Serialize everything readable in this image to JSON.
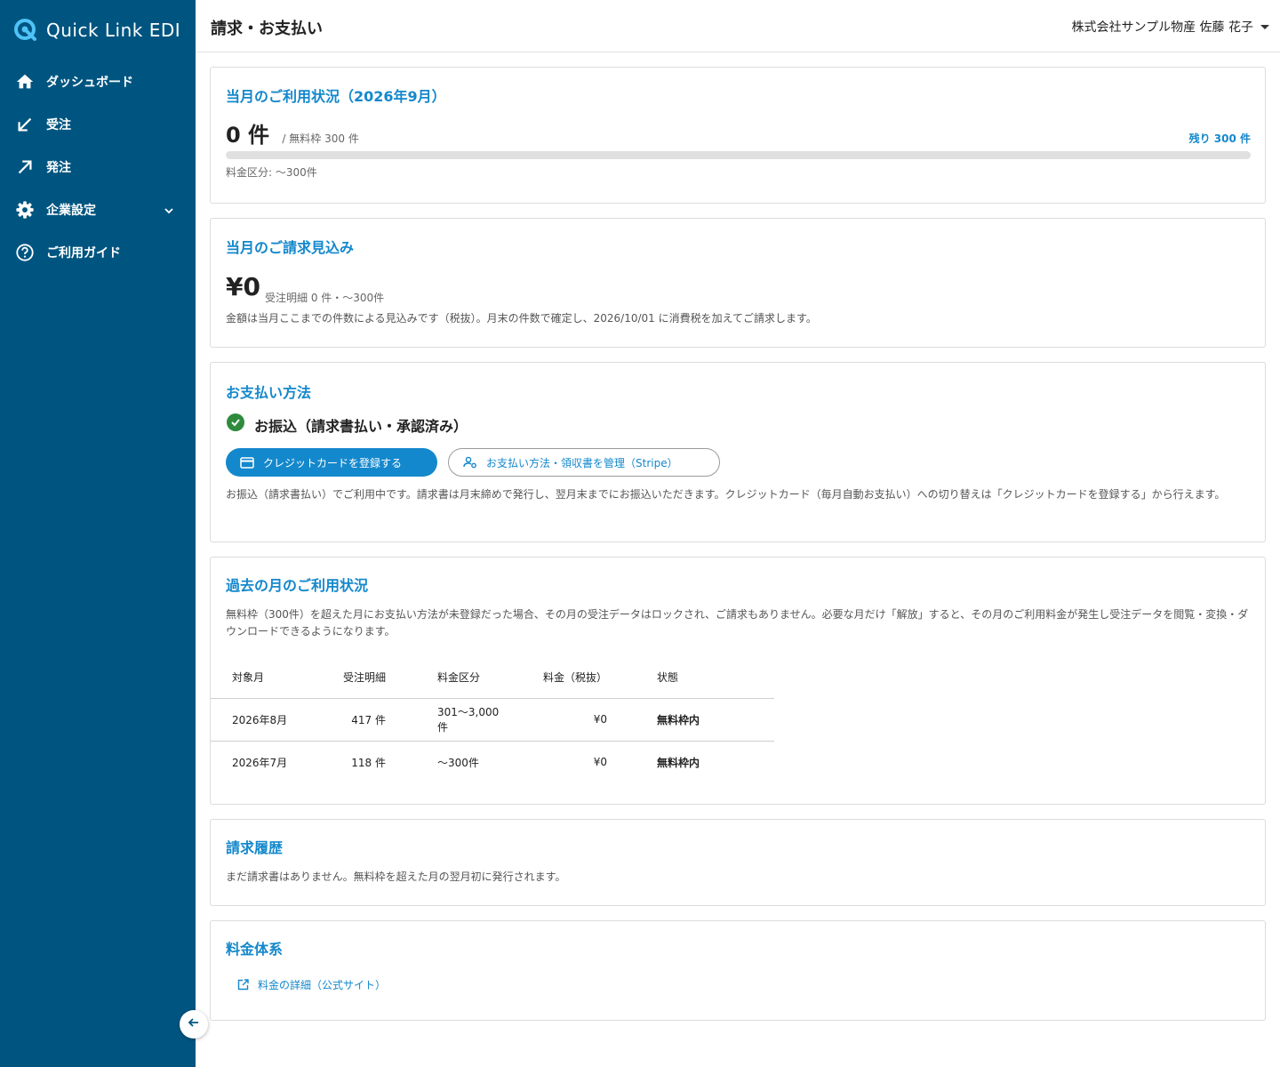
{
  "app": {
    "name": "Quick Link EDI",
    "brand_color": "#005580",
    "accent_color": "#1488cc"
  },
  "sidebar": {
    "items": [
      {
        "label": "ダッシュボード",
        "icon": "home-icon"
      },
      {
        "label": "受注",
        "icon": "arrow-down-left-icon"
      },
      {
        "label": "発注",
        "icon": "arrow-up-right-icon"
      },
      {
        "label": "企業設定",
        "icon": "gear-icon"
      },
      {
        "label": "ご利用ガイド",
        "icon": "help-circle-icon"
      }
    ]
  },
  "header": {
    "title": "請求・お支払い",
    "user": "株式会社サンプル物産 佐藤 花子"
  },
  "usage": {
    "title": "当月のご利用状況（2026年9月）",
    "count": "0 件",
    "quota": "/ 無料枠 300 件",
    "remaining": "残り 300 件",
    "progress_fraction": 0,
    "tier": "料金区分: 〜300件"
  },
  "estimate": {
    "title": "当月のご請求見込み",
    "amount": "¥0",
    "detail": "受注明細 0 件・〜300件",
    "note": "金額は当月ここまでの件数による見込みです（税抜）。月末の件数で確定し、2026/10/01 に消費税を加えてご請求します。"
  },
  "payment": {
    "title": "お支払い方法",
    "method": "お振込（請求書払い・承認済み）",
    "register_card_label": "クレジットカードを登録する",
    "manage_label": "お支払い方法・領収書を管理（Stripe）",
    "note": "お振込（請求書払い）でご利用中です。請求書は月末締めで発行し、翌月末までにお振込いただきます。クレジットカード（毎月自動お支払い）への切り替えは「クレジットカードを登録する」から行えます。"
  },
  "history_usage": {
    "title": "過去の月のご利用状況",
    "note": "無料枠（300件）を超えた月にお支払い方法が未登録だった場合、その月の受注データはロックされ、ご請求もありません。必要な月だけ「解放」すると、その月のご利用料金が発生し受注データを閲覧・変換・ダウンロードできるようになります。",
    "columns": [
      "対象月",
      "受注明細",
      "料金区分",
      "料金（税抜）",
      "状態"
    ],
    "rows": [
      [
        "2026年8月",
        "417 件",
        "301〜3,000件",
        "¥0",
        "無料枠内"
      ],
      [
        "2026年7月",
        "118 件",
        "〜300件",
        "¥0",
        "無料枠内"
      ]
    ]
  },
  "invoices": {
    "title": "請求履歴",
    "note": "まだ請求書はありません。無料枠を超えた月の翌月初に発行されます。"
  },
  "pricing": {
    "title": "料金体系",
    "link_label": "料金の詳細（公式サイト）"
  }
}
